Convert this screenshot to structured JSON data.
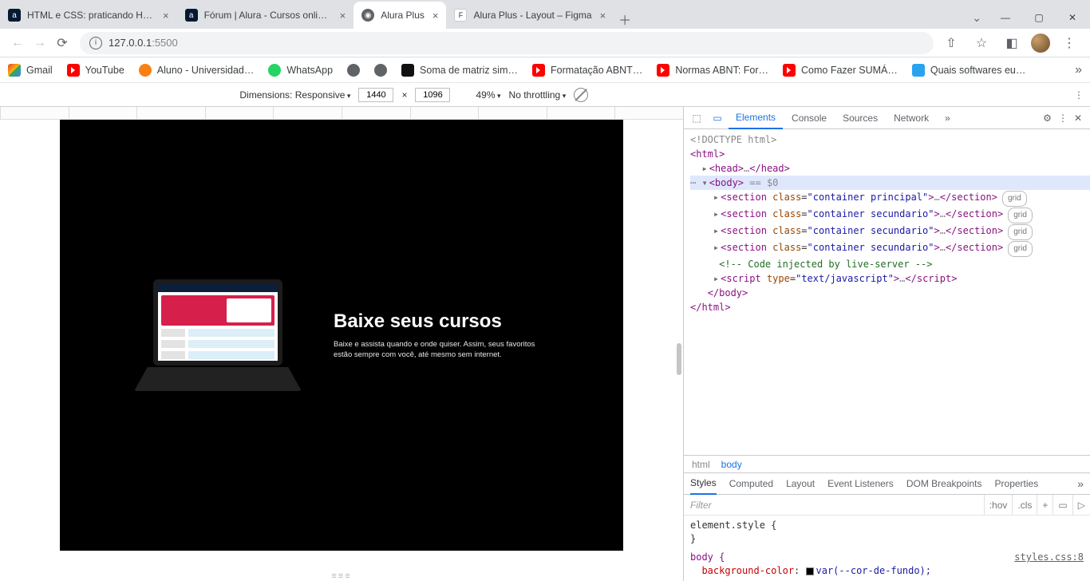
{
  "tabs": [
    {
      "label": "HTML e CSS: praticando HTML/C",
      "fav": "alura"
    },
    {
      "label": "Fórum | Alura - Cursos online de",
      "fav": "alura"
    },
    {
      "label": "Alura Plus",
      "fav": "globe",
      "active": true
    },
    {
      "label": "Alura Plus - Layout – Figma",
      "fav": "figma"
    }
  ],
  "window_buttons": {
    "chev": "⌄",
    "min": "—",
    "max": "▢",
    "close": "✕"
  },
  "toolbar": {
    "back": "←",
    "forward": "→",
    "reload": "⟳",
    "url_host": "127.0.0.1",
    "url_port": ":5500",
    "share": "⇧",
    "star": "☆",
    "panel": "◧",
    "menu": "⋮"
  },
  "bookmarks": [
    {
      "label": "Gmail",
      "ico": "gmail"
    },
    {
      "label": "YouTube",
      "ico": "yt"
    },
    {
      "label": "Aluno - Universidad…",
      "ico": "moodle"
    },
    {
      "label": "WhatsApp",
      "ico": "wa"
    },
    {
      "label": "",
      "ico": "grey"
    },
    {
      "label": "",
      "ico": "grey"
    },
    {
      "label": "Soma de matriz sim…",
      "ico": "matrix"
    },
    {
      "label": "Formatação ABNT…",
      "ico": "yt"
    },
    {
      "label": "Normas ABNT: For…",
      "ico": "yt"
    },
    {
      "label": "Como Fazer SUMÁ…",
      "ico": "yt"
    },
    {
      "label": "Quais softwares eu…",
      "ico": "sw"
    }
  ],
  "device_bar": {
    "dimensions_label": "Dimensions: Responsive",
    "width": "1440",
    "x": "×",
    "height": "1096",
    "zoom": "49%",
    "throttle": "No throttling",
    "kebab": "⋮"
  },
  "hero": {
    "title": "Baixe seus cursos",
    "body": "Baixe e assista quando e onde quiser. Assim, seus favoritos estão sempre com você, até mesmo sem internet."
  },
  "devtools_tabs": {
    "elements": "Elements",
    "console": "Console",
    "sources": "Sources",
    "network": "Network",
    "more": "»",
    "gear": "⚙",
    "kebab": "⋮",
    "close": "✕"
  },
  "dom": {
    "doctype": "<!DOCTYPE html>",
    "html_open": "<html>",
    "head": "<head>…</head>",
    "body_open": "<body>",
    "body_meta": " == $0",
    "sec_p_open": "<section class=\"container principal\">",
    "sec_close": "…</section>",
    "sec_s_open": "<section class=\"container secundario\">",
    "comment": "<!-- Code injected by live-server -->",
    "script": "<script type=\"text/javascript\">…</script>",
    "body_close": "</body>",
    "html_close": "</html>",
    "grid_badge": "grid"
  },
  "crumbs": {
    "html": "html",
    "body": "body"
  },
  "styles_tabs": {
    "styles": "Styles",
    "computed": "Computed",
    "layout": "Layout",
    "events": "Event Listeners",
    "dom_bp": "DOM Breakpoints",
    "props": "Properties",
    "more": "»"
  },
  "filter": {
    "placeholder": "Filter",
    "hov": ":hov",
    "cls": ".cls",
    "plus": "+"
  },
  "rules": {
    "element_style": "element.style {",
    "close": "}",
    "body_sel": "body {",
    "src": "styles.css:8",
    "prop": "background-color",
    "val": "var(--cor-de-fundo);"
  }
}
